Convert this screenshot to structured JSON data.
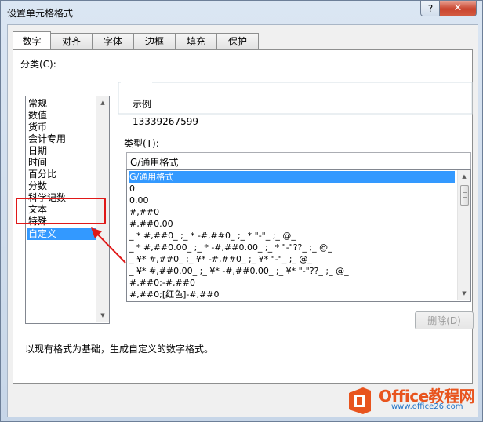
{
  "window": {
    "title": "设置单元格格式",
    "help_label": "?",
    "close_label": "✕"
  },
  "tabs": [
    {
      "label": "数字",
      "active": true
    },
    {
      "label": "对齐"
    },
    {
      "label": "字体"
    },
    {
      "label": "边框"
    },
    {
      "label": "填充"
    },
    {
      "label": "保护"
    }
  ],
  "category": {
    "label": "分类(C):",
    "items": [
      "常规",
      "数值",
      "货币",
      "会计专用",
      "日期",
      "时间",
      "百分比",
      "分数",
      "科学记数",
      "文本",
      "特殊",
      "自定义"
    ],
    "selected": "自定义"
  },
  "sample": {
    "label": "示例",
    "value": "13339267599"
  },
  "type": {
    "label": "类型(T):",
    "value": "G/通用格式",
    "items": [
      "G/通用格式",
      "0",
      "0.00",
      "#,##0",
      "#,##0.00",
      "_ * #,##0_ ;_ * -#,##0_ ;_ * \"-\"_ ;_ @_",
      "_ * #,##0.00_ ;_ * -#,##0.00_ ;_ * \"-\"??_ ;_ @_",
      "_ ¥* #,##0_ ;_ ¥* -#,##0_ ;_ ¥* \"-\"_ ;_ @_",
      "_ ¥* #,##0.00_ ;_ ¥* -#,##0.00_ ;_ ¥* \"-\"??_ ;_ @_",
      "#,##0;-#,##0",
      "#,##0;[红色]-#,##0"
    ]
  },
  "delete_button": "删除(D)",
  "description": "以现有格式为基础，生成自定义的数字格式。",
  "watermark": {
    "brand": "Office教程网",
    "url": "www.office26.com"
  },
  "colors": {
    "selection": "#3399ff",
    "annotation": "#e01818",
    "brand_orange": "#e8541e"
  }
}
